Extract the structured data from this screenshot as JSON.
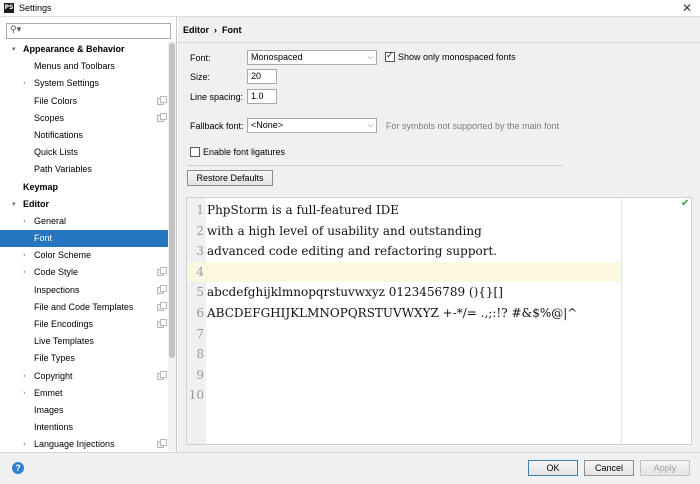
{
  "window": {
    "title": "Settings",
    "app_icon": "PS"
  },
  "search": {
    "value": "",
    "placeholder": ""
  },
  "tree": [
    {
      "label": "Appearance & Behavior",
      "bold": true,
      "level": 0,
      "arrow": "down"
    },
    {
      "label": "Menus and Toolbars",
      "level": 1
    },
    {
      "label": "System Settings",
      "level": 1,
      "arrow": "right"
    },
    {
      "label": "File Colors",
      "level": 1,
      "project": true
    },
    {
      "label": "Scopes",
      "level": 1,
      "project": true
    },
    {
      "label": "Notifications",
      "level": 1
    },
    {
      "label": "Quick Lists",
      "level": 1
    },
    {
      "label": "Path Variables",
      "level": 1
    },
    {
      "label": "Keymap",
      "bold": true,
      "level": 0
    },
    {
      "label": "Editor",
      "bold": true,
      "level": 0,
      "arrow": "down"
    },
    {
      "label": "General",
      "level": 1,
      "arrow": "right"
    },
    {
      "label": "Font",
      "level": 1,
      "selected": true
    },
    {
      "label": "Color Scheme",
      "level": 1,
      "arrow": "right"
    },
    {
      "label": "Code Style",
      "level": 1,
      "arrow": "right",
      "project": true
    },
    {
      "label": "Inspections",
      "level": 1,
      "project": true
    },
    {
      "label": "File and Code Templates",
      "level": 1,
      "project": true
    },
    {
      "label": "File Encodings",
      "level": 1,
      "project": true
    },
    {
      "label": "Live Templates",
      "level": 1
    },
    {
      "label": "File Types",
      "level": 1
    },
    {
      "label": "Copyright",
      "level": 1,
      "arrow": "right",
      "project": true
    },
    {
      "label": "Emmet",
      "level": 1,
      "arrow": "right"
    },
    {
      "label": "Images",
      "level": 1
    },
    {
      "label": "Intentions",
      "level": 1
    },
    {
      "label": "Language Injections",
      "level": 1,
      "arrow": "right",
      "project": true
    }
  ],
  "breadcrumb": {
    "parent": "Editor",
    "separator": "›",
    "current": "Font"
  },
  "font": {
    "label": "Font:",
    "value": "Monospaced",
    "monospaced_only_label": "Show only monospaced fonts",
    "monospaced_only_checked": true
  },
  "size": {
    "label": "Size:",
    "value": "20"
  },
  "line_spacing": {
    "label": "Line spacing:",
    "value": "1.0"
  },
  "fallback": {
    "label": "Fallback font:",
    "value": "<None>",
    "hint": "For symbols not supported by the main font"
  },
  "ligatures": {
    "label": "Enable font ligatures",
    "checked": false
  },
  "restore_defaults": "Restore Defaults",
  "preview_lines": [
    {
      "num": "1",
      "text": "PhpStorm is a full-featured IDE"
    },
    {
      "num": "2",
      "text": "with a high level of usability and outstanding"
    },
    {
      "num": "3",
      "text": "advanced code editing and refactoring support."
    },
    {
      "num": "4",
      "text": ""
    },
    {
      "num": "5",
      "text": "abcdefghijklmnopqrstuvwxyz 0123456789 (){}[]"
    },
    {
      "num": "6",
      "text": "ABCDEFGHIJKLMNOPQRSTUVWXYZ +-*/= .,;:!? #&$%@|^"
    },
    {
      "num": "7",
      "text": ""
    },
    {
      "num": "8",
      "text": ""
    },
    {
      "num": "9",
      "text": ""
    },
    {
      "num": "10",
      "text": ""
    }
  ],
  "current_line": 4,
  "buttons": {
    "ok": "OK",
    "cancel": "Cancel",
    "apply": "Apply",
    "help": "?"
  },
  "colors": {
    "selection": "#2675bf",
    "current_line": "#fcf8df",
    "help": "#2d7fd3"
  }
}
